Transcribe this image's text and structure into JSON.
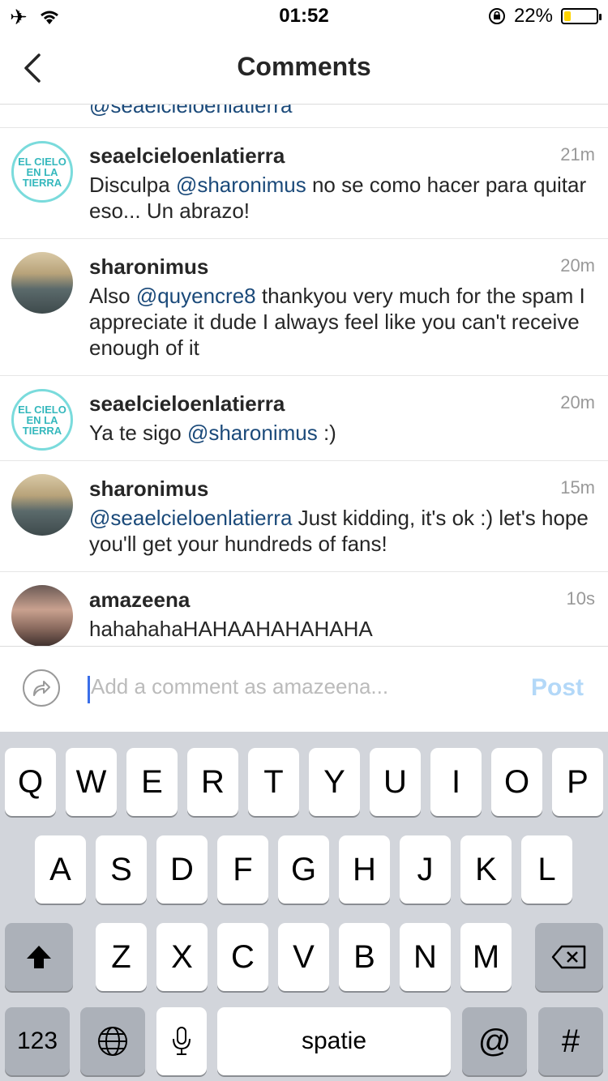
{
  "status": {
    "time": "01:52",
    "battery": "22%",
    "battery_level": 0.22
  },
  "header": {
    "title": "Comments",
    "back_icon": "chevron-left-icon"
  },
  "comments": [
    {
      "username": "seaelcieloenlatierra",
      "time": "21m",
      "before": "Disculpa ",
      "mention": "@sharonimus",
      "after": " no se como hacer para quitar eso... Un abrazo!",
      "avatar_text": "EL CIELO EN LA TIERRA"
    },
    {
      "username": "sharonimus",
      "time": "20m",
      "before": "Also ",
      "mention": "@quyencre8",
      "after": " thankyou very much for the spam I appreciate it dude I always feel like you can't receive enough of it"
    },
    {
      "username": "seaelcieloenlatierra",
      "time": "20m",
      "before": "Ya te sigo ",
      "mention": "@sharonimus",
      "after": " :)",
      "avatar_text": "EL CIELO EN LA TIERRA"
    },
    {
      "username": "sharonimus",
      "time": "15m",
      "before": "",
      "mention": "@seaelcieloenlatierra",
      "after": " Just kidding, it's ok :) let's hope you'll get your hundreds of fans!"
    },
    {
      "username": "amazeena",
      "time": "10s",
      "before": "",
      "mention": "",
      "after": "hahahahaHAHAAHAHAHAHA"
    }
  ],
  "cut_off_mention": "@seaelcieloenlatierra",
  "composer": {
    "placeholder": "Add a comment as amazeena...",
    "post_label": "Post",
    "reply_icon": "share-arrow-icon"
  },
  "keyboard": {
    "row1": [
      "Q",
      "W",
      "E",
      "R",
      "T",
      "Y",
      "U",
      "I",
      "O",
      "P"
    ],
    "row2": [
      "A",
      "S",
      "D",
      "F",
      "G",
      "H",
      "J",
      "K",
      "L"
    ],
    "row3": [
      "Z",
      "X",
      "C",
      "V",
      "B",
      "N",
      "M"
    ],
    "numbers_label": "123",
    "space_label": "spatie",
    "at_label": "@",
    "hash_label": "#"
  }
}
